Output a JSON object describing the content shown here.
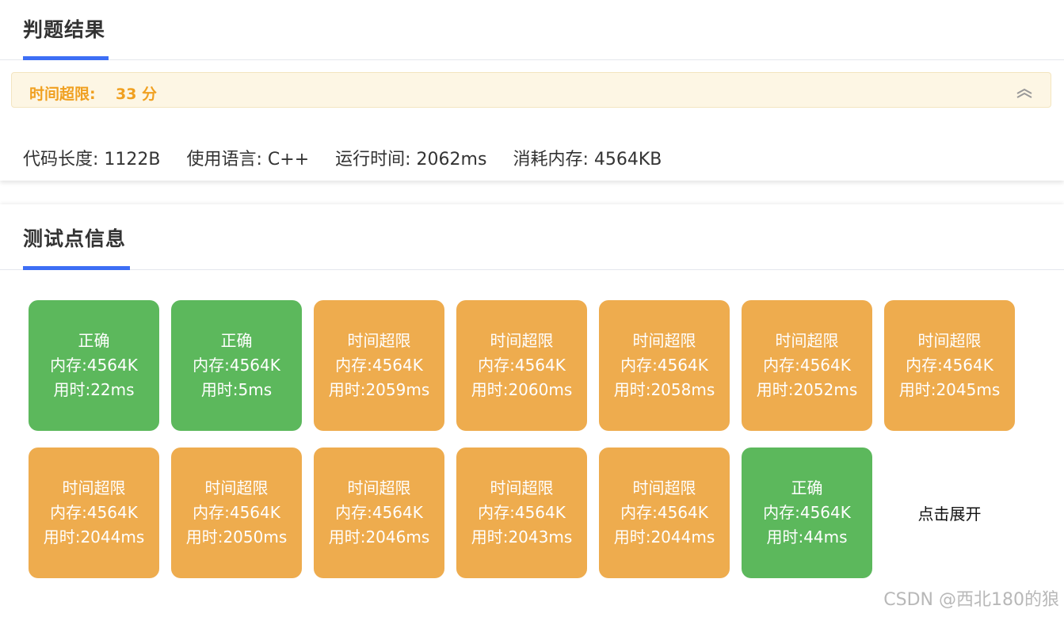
{
  "result_tab": {
    "title": "判题结果"
  },
  "status": {
    "label": "时间超限:",
    "score": "33 分"
  },
  "colors": {
    "accent": "#3d6ef5",
    "correct": "#5cb85c",
    "tle": "#eeac4e",
    "status_text": "#f0a020",
    "status_bg": "#fdf6e4"
  },
  "meta": {
    "code_length": "代码长度: 1122B",
    "language": "使用语言: C++",
    "run_time": "运行时间: 2062ms",
    "memory": "消耗内存: 4564KB"
  },
  "tests_tab": {
    "title": "测试点信息"
  },
  "test_cases": [
    {
      "status": "正确",
      "memory": "内存:4564K",
      "time": "用时:22ms",
      "kind": "correct"
    },
    {
      "status": "正确",
      "memory": "内存:4564K",
      "time": "用时:5ms",
      "kind": "correct"
    },
    {
      "status": "时间超限",
      "memory": "内存:4564K",
      "time": "用时:2059ms",
      "kind": "tle"
    },
    {
      "status": "时间超限",
      "memory": "内存:4564K",
      "time": "用时:2060ms",
      "kind": "tle"
    },
    {
      "status": "时间超限",
      "memory": "内存:4564K",
      "time": "用时:2058ms",
      "kind": "tle"
    },
    {
      "status": "时间超限",
      "memory": "内存:4564K",
      "time": "用时:2052ms",
      "kind": "tle"
    },
    {
      "status": "时间超限",
      "memory": "内存:4564K",
      "time": "用时:2045ms",
      "kind": "tle"
    },
    {
      "status": "时间超限",
      "memory": "内存:4564K",
      "time": "用时:2044ms",
      "kind": "tle"
    },
    {
      "status": "时间超限",
      "memory": "内存:4564K",
      "time": "用时:2050ms",
      "kind": "tle"
    },
    {
      "status": "时间超限",
      "memory": "内存:4564K",
      "time": "用时:2046ms",
      "kind": "tle"
    },
    {
      "status": "时间超限",
      "memory": "内存:4564K",
      "time": "用时:2043ms",
      "kind": "tle"
    },
    {
      "status": "时间超限",
      "memory": "内存:4564K",
      "time": "用时:2044ms",
      "kind": "tle"
    },
    {
      "status": "正确",
      "memory": "内存:4564K",
      "time": "用时:44ms",
      "kind": "correct"
    }
  ],
  "expand_label": "点击展开",
  "collapse_icon": "chevrons-up-icon",
  "watermark": "CSDN @西北180的狼"
}
